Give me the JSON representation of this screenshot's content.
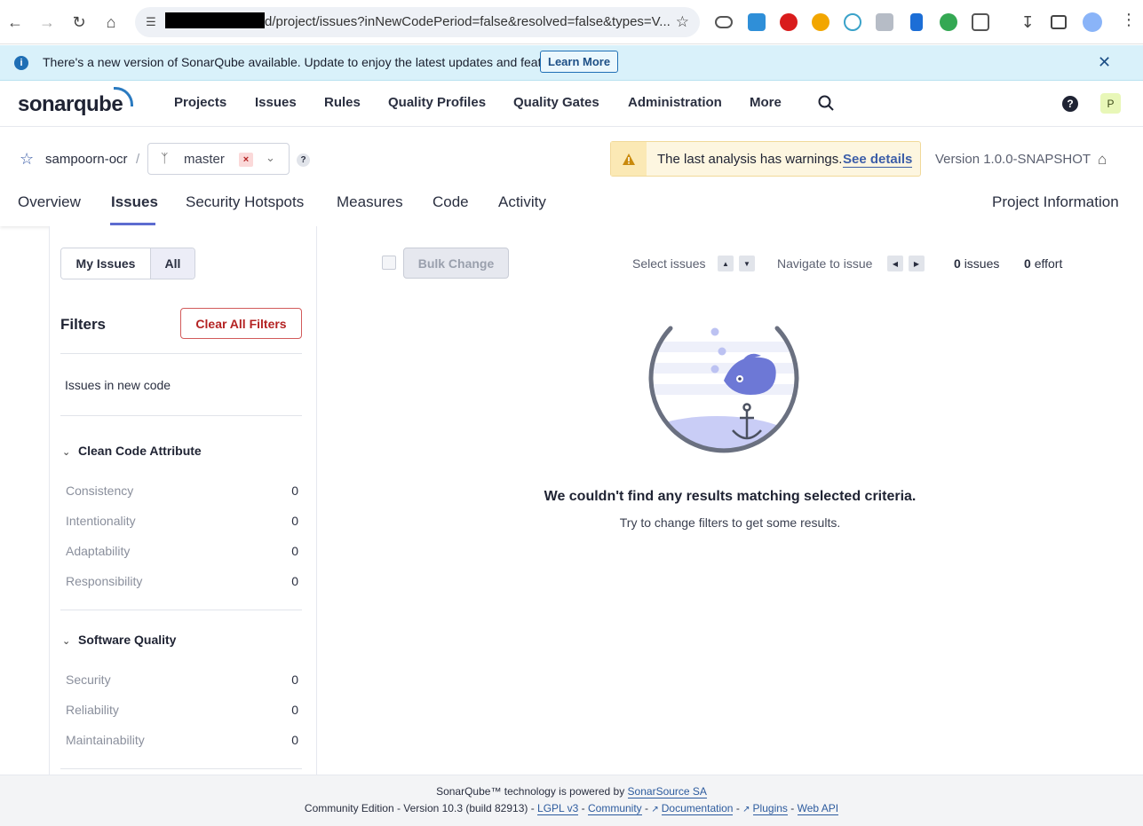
{
  "browser": {
    "url": "d/project/issues?inNewCodePeriod=false&resolved=false&types=V..."
  },
  "banner": {
    "message": "There's a new version of SonarQube available. Update to enjoy the latest updates and features.",
    "learn_more": "Learn More"
  },
  "nav": {
    "logo": "sonarqube",
    "items": [
      "Projects",
      "Issues",
      "Rules",
      "Quality Profiles",
      "Quality Gates",
      "Administration",
      "More"
    ],
    "user_initial": "P"
  },
  "project": {
    "name": "sampoorn-ocr",
    "branch": "master",
    "warning_text": "The last analysis has warnings.",
    "warning_link": "See details",
    "version": "Version 1.0.0-SNAPSHOT",
    "tabs": [
      "Overview",
      "Issues",
      "Security Hotspots",
      "Measures",
      "Code",
      "Activity"
    ],
    "info_tab": "Project Information"
  },
  "sidebar": {
    "toggle": [
      "My Issues",
      "All"
    ],
    "filters_title": "Filters",
    "clear_all": "Clear All Filters",
    "new_code": "Issues in new code",
    "sections": [
      {
        "title": "Clean Code Attribute",
        "rows": [
          {
            "label": "Consistency",
            "count": "0"
          },
          {
            "label": "Intentionality",
            "count": "0"
          },
          {
            "label": "Adaptability",
            "count": "0"
          },
          {
            "label": "Responsibility",
            "count": "0"
          }
        ]
      },
      {
        "title": "Software Quality",
        "rows": [
          {
            "label": "Security",
            "count": "0"
          },
          {
            "label": "Reliability",
            "count": "0"
          },
          {
            "label": "Maintainability",
            "count": "0"
          }
        ]
      }
    ]
  },
  "main": {
    "bulk_change": "Bulk Change",
    "select_issues": "Select issues",
    "navigate_to_issue": "Navigate to issue",
    "issues_count": "0",
    "issues_label": "issues",
    "effort_count": "0",
    "effort_label": "effort",
    "empty_title": "We couldn't find any results matching selected criteria.",
    "empty_sub": "Try to change filters to get some results."
  },
  "footer": {
    "line1_prefix": "SonarQube™ technology is powered by",
    "line1_link": "SonarSource SA",
    "edition": "Community Edition - Version 10.3 (build 82913) -",
    "links": [
      "LGPL v3",
      "Community",
      "Documentation",
      "Plugins",
      "Web API"
    ],
    "sep": "-"
  },
  "colors": {
    "accent": "#5d6cd0",
    "banner_bg": "#d9f1fa",
    "warning_bg": "#fdf6e0",
    "danger": "#b42323"
  }
}
